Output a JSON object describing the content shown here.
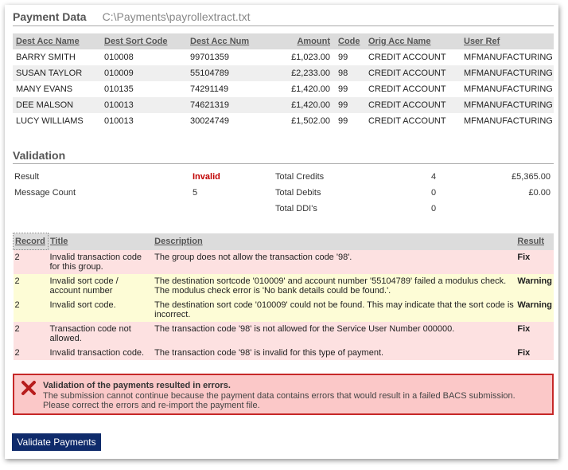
{
  "payment": {
    "title": "Payment Data",
    "path": "C:\\Payments\\payrollextract.txt",
    "columns": [
      "Dest Acc Name",
      "Dest Sort Code",
      "Dest Acc Num",
      "Amount",
      "Code",
      "Orig Acc Name",
      "User Ref"
    ],
    "rows": [
      [
        "BARRY SMITH",
        "010008",
        "99701359",
        "£1,023.00",
        "99",
        "CREDIT ACCOUNT",
        "MFMANUFACTURING"
      ],
      [
        "SUSAN TAYLOR",
        "010009",
        "55104789",
        "£2,233.00",
        "98",
        "CREDIT ACCOUNT",
        "MFMANUFACTURING"
      ],
      [
        "MANY EVANS",
        "010135",
        "74291149",
        "£1,420.00",
        "99",
        "CREDIT ACCOUNT",
        "MFMANUFACTURING"
      ],
      [
        "DEE MALSON",
        "010013",
        "74621319",
        "£1,420.00",
        "99",
        "CREDIT ACCOUNT",
        "MFMANUFACTURING"
      ],
      [
        "LUCY WILLIAMS",
        "010013",
        "30024749",
        "£1,502.00",
        "99",
        "CREDIT ACCOUNT",
        "MFMANUFACTURING"
      ]
    ]
  },
  "validation": {
    "title": "Validation",
    "result_label": "Result",
    "result_value": "Invalid",
    "message_count_label": "Message Count",
    "message_count_value": "5",
    "total_credits_label": "Total Credits",
    "total_credits_count": "4",
    "total_credits_amount": "£5,365.00",
    "total_debits_label": "Total Debits",
    "total_debits_count": "0",
    "total_debits_amount": "£0.00",
    "total_ddis_label": "Total DDI's",
    "total_ddis_count": "0"
  },
  "results": {
    "columns": [
      "Record",
      "Title",
      "Description",
      "Result"
    ],
    "rows": [
      {
        "record": "2",
        "title": "Invalid transaction code for this group.",
        "description": "The group does not allow the transaction code '98'.",
        "result": "Fix",
        "kind": "fix"
      },
      {
        "record": "2",
        "title": "Invalid sort code / account number",
        "description": "The destination sortcode '010009' and account number '55104789' failed a modulus check. The modulus check error is 'No bank details could be found.'.",
        "result": "Warning",
        "kind": "warn"
      },
      {
        "record": "2",
        "title": "Invalid sort code.",
        "description": "The destination sort code '010009' could not be found. This may indicate that the sort code is incorrect.",
        "result": "Warning",
        "kind": "warn"
      },
      {
        "record": "2",
        "title": "Transaction code not allowed.",
        "description": "The transaction code '98' is not allowed for the Service User Number 000000.",
        "result": "Fix",
        "kind": "fix"
      },
      {
        "record": "2",
        "title": "Invalid transaction code.",
        "description": "The transaction code '98' is invalid for this type of payment.",
        "result": "Fix",
        "kind": "fix"
      }
    ]
  },
  "error": {
    "icon": "close-x-icon",
    "color": "#c62828",
    "title": "Validation of the payments resulted in errors.",
    "message": "The submission cannot continue because the payment data contains errors that would result in a failed BACS submission. Please correct the errors and re-import the payment file."
  },
  "actions": {
    "validate_label": "Validate Payments",
    "button_color": "#0f2b6b"
  }
}
